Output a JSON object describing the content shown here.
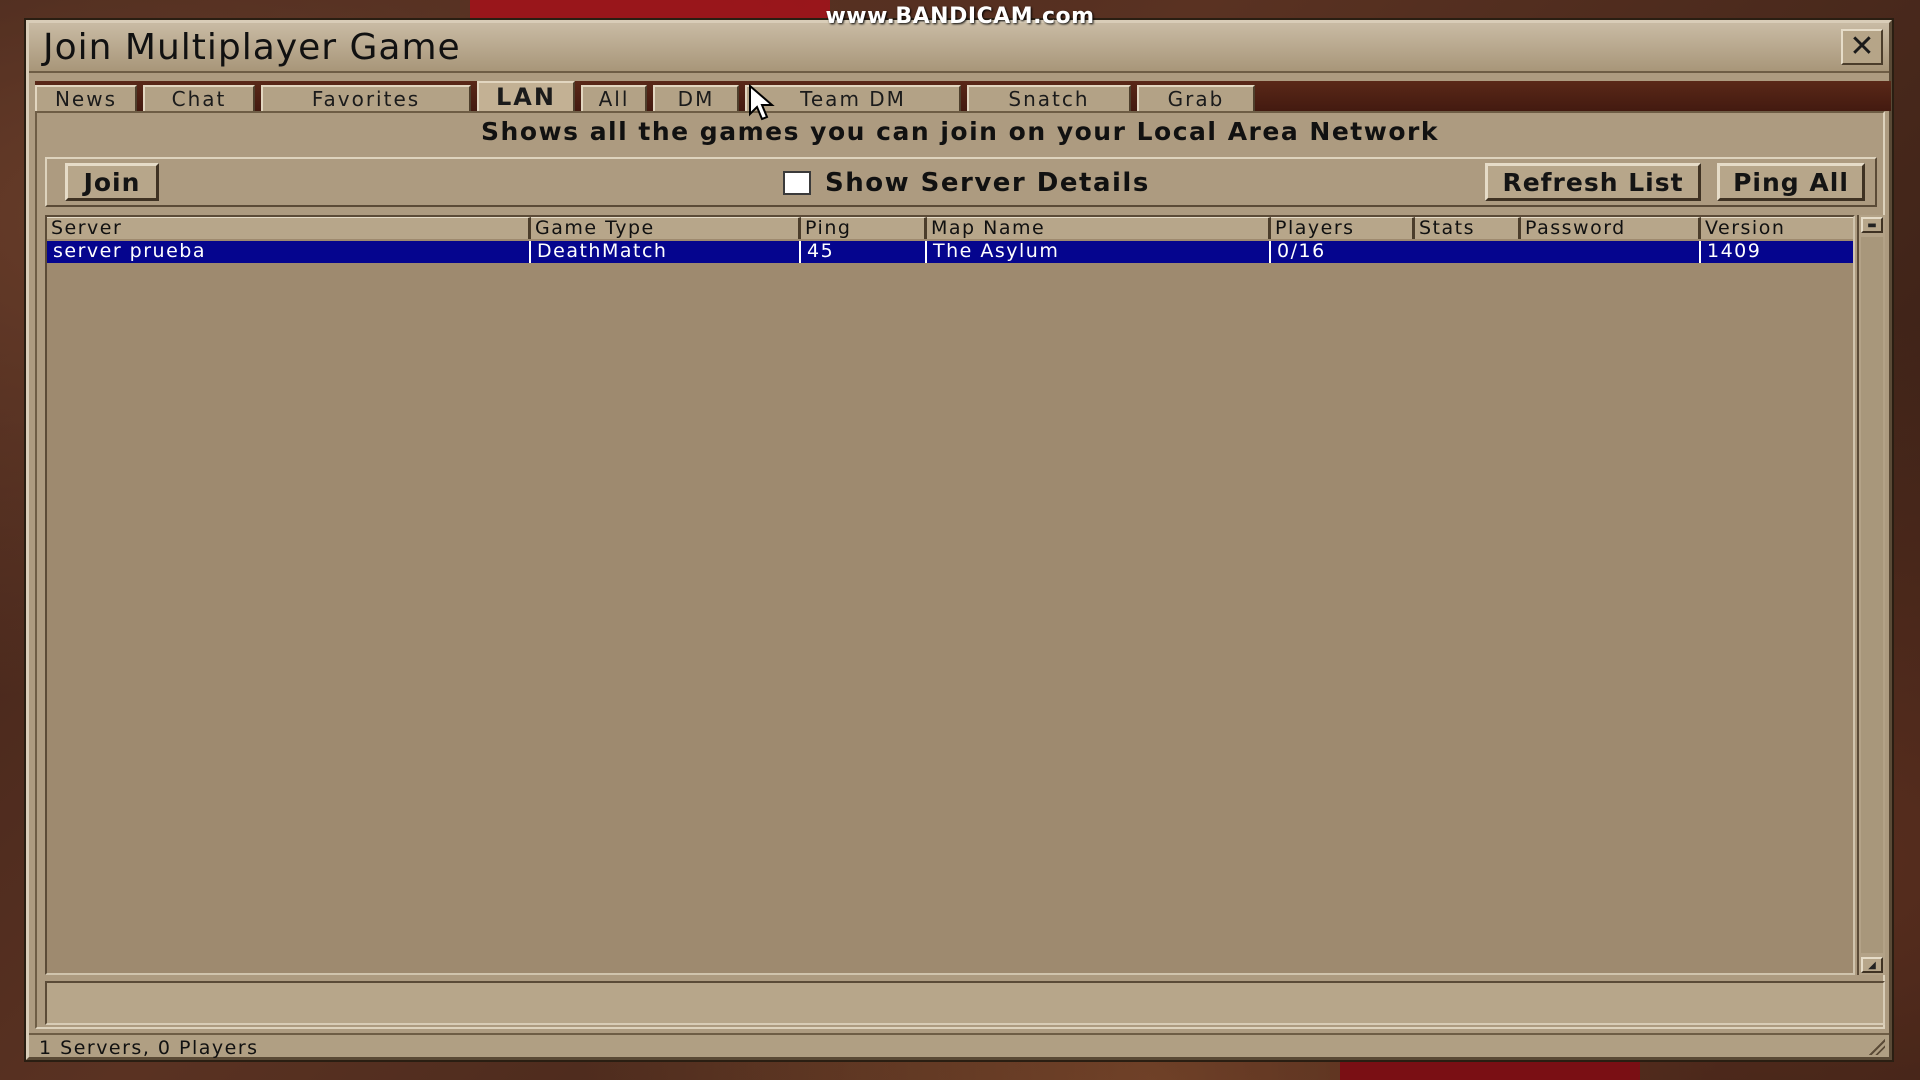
{
  "watermark": "www.BANDICAM.com",
  "window": {
    "title": "Join Multiplayer Game",
    "close_icon": "close-icon"
  },
  "tabs": [
    {
      "label": "News",
      "active": false
    },
    {
      "label": "Chat",
      "active": false
    },
    {
      "label": "Favorites",
      "active": false
    },
    {
      "label": "LAN",
      "active": true
    },
    {
      "label": "All",
      "active": false
    },
    {
      "label": "DM",
      "active": false
    },
    {
      "label": "Team DM",
      "active": false
    },
    {
      "label": "Snatch",
      "active": false
    },
    {
      "label": "Grab",
      "active": false
    }
  ],
  "description": "Shows all the games you can join on your Local Area Network",
  "toolbar": {
    "join_label": "Join",
    "show_details_label": "Show Server Details",
    "show_details_checked": false,
    "refresh_label": "Refresh List",
    "ping_all_label": "Ping All"
  },
  "server_list": {
    "columns": [
      "Server",
      "Game Type",
      "Ping",
      "Map Name",
      "Players",
      "Stats",
      "Password",
      "Version"
    ],
    "rows": [
      {
        "server": "server prueba",
        "game_type": "DeathMatch",
        "ping": "45",
        "map_name": "The Asylum",
        "players": "0/16",
        "stats": "",
        "password": "",
        "version": "1409",
        "selected": true
      }
    ]
  },
  "status": {
    "text": "1 Servers, 0 Players"
  },
  "colors": {
    "window_bg": "#ad9b80",
    "selection": "#05058e",
    "tab_strip": "#4a1e12"
  }
}
